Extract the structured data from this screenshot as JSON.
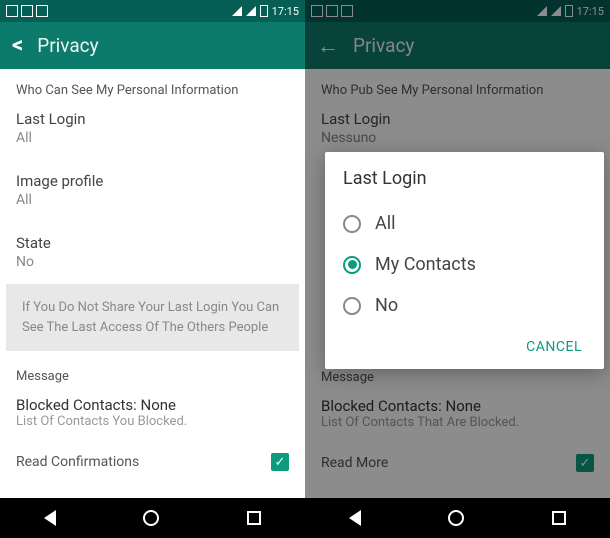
{
  "statusBar": {
    "time": "17:15"
  },
  "left": {
    "header": {
      "title": "Privacy"
    },
    "sectionHeader": "Who Can See My Personal Information",
    "lastLogin": {
      "title": "Last Login",
      "value": "All"
    },
    "imageProfile": {
      "title": "Image profile",
      "value": "All"
    },
    "state": {
      "title": "State",
      "value": "No"
    },
    "infoBox": "If You Do Not Share Your Last Login You Can See The Last Access Of The Others People",
    "messageSection": "Message",
    "blocked": {
      "title": "Blocked Contacts: None",
      "sub": "List Of Contacts You Blocked."
    },
    "readConfirm": "Read Confirmations"
  },
  "right": {
    "header": {
      "title": "Privacy"
    },
    "sectionHeader": "Who Pub See My Personal Information",
    "lastLogin": {
      "title": "Last Login",
      "value": "Nessuno"
    },
    "messageSection": "Message",
    "blocked": {
      "title": "Blocked Contacts: None",
      "sub": "List Of Contacts That Are Blocked."
    },
    "readMore": "Read More",
    "dialog": {
      "title": "Last Login",
      "options": {
        "all": "All",
        "contacts": "My Contacts",
        "no": "No"
      },
      "cancel": "CANCEL"
    }
  }
}
